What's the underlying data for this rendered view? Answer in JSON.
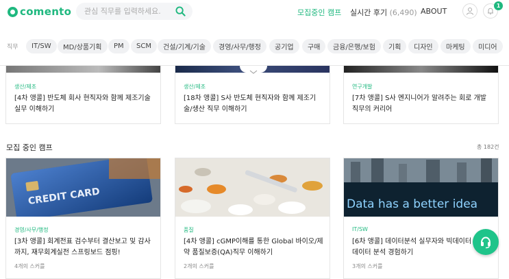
{
  "header": {
    "logo_text": "comento",
    "search_placeholder": "관심 직무를 입력하세요.",
    "nav_camp": "모집중인 캠프",
    "nav_review": "실시간 후기",
    "nav_review_count": "(6,490)",
    "nav_about": "ABOUT",
    "notification_count": "1"
  },
  "chipbar": {
    "label": "직무",
    "chips": [
      "IT/SW",
      "MD/상품기획",
      "PM",
      "SCM",
      "건설/기계/기술",
      "경영/사무/행정",
      "공기업",
      "구매",
      "금융/은행/보험",
      "기획",
      "디자인",
      "마케팅",
      "미디어"
    ]
  },
  "top_cards": [
    {
      "category": "생산/제조",
      "title": "[4차 앵콜] 반도체 회사 현직자와 함께 제조기술 실무 이해하기"
    },
    {
      "category": "생산/제조",
      "title": "[18차 앵콜] S사 반도체 현직자와 함께 제조기술/생산 직무 이해하기"
    },
    {
      "category": "연구개발",
      "title": "[7차 앵콜] S사 엔지니어가 알려주는 회로 개발 직무의 커리어"
    }
  ],
  "section": {
    "title": "모집 중인 캠프",
    "count": "총 182건"
  },
  "camp_cards": [
    {
      "category": "경영/사무/행정",
      "title": "[3차 앵콜] 회계전표 검수부터 결산보고 및 감사까지, 재무회계실전 스프링보드 점핑!",
      "meta": "4개의 스커를",
      "image_text": "CREDIT CARD"
    },
    {
      "category": "품질",
      "title": "[4차 앵콜] cGMP이해를 통한 Global 바이오/제약 품질보증(QA)직무 이해하기",
      "meta": "2개의 스커를"
    },
    {
      "category": "IT/SW",
      "title": "[6차 앵콜] 데이터분석 실무자와 빅데이터 부터 데이터 분석 경험하기",
      "meta": "3개의 스커를",
      "image_text": "Data has a better idea"
    }
  ]
}
